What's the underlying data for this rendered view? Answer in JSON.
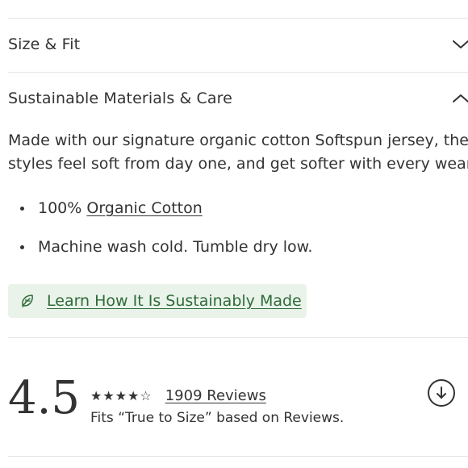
{
  "accordion": {
    "size_fit": {
      "title": "Size & Fit",
      "icon": "chevron-down-icon"
    },
    "materials_care": {
      "title": "Sustainable Materials & Care",
      "icon": "chevron-up-icon",
      "description_line1": "Made with our signature organic cotton Softspun jersey, these",
      "description_line2": "styles feel soft from day one, and get softer with every wear.",
      "bullet1_prefix": "100%",
      "bullet1_link": "Organic Cotton",
      "bullet2": "Machine wash cold. Tumble dry low.",
      "sustain_button": {
        "label": "Learn How It Is Sustainably Made",
        "icon": "leaf-icon",
        "background": "#eaf3ea",
        "text_color": "#2f6b3a"
      }
    }
  },
  "reviews": {
    "rating": "4.5",
    "stars": "★★★★☆",
    "star_rating_value": 4.5,
    "count_link": "1909 Reviews",
    "fit_text": "Fits “True to Size” based on Reviews.",
    "jump_icon": "arrow-down-circle-icon"
  }
}
